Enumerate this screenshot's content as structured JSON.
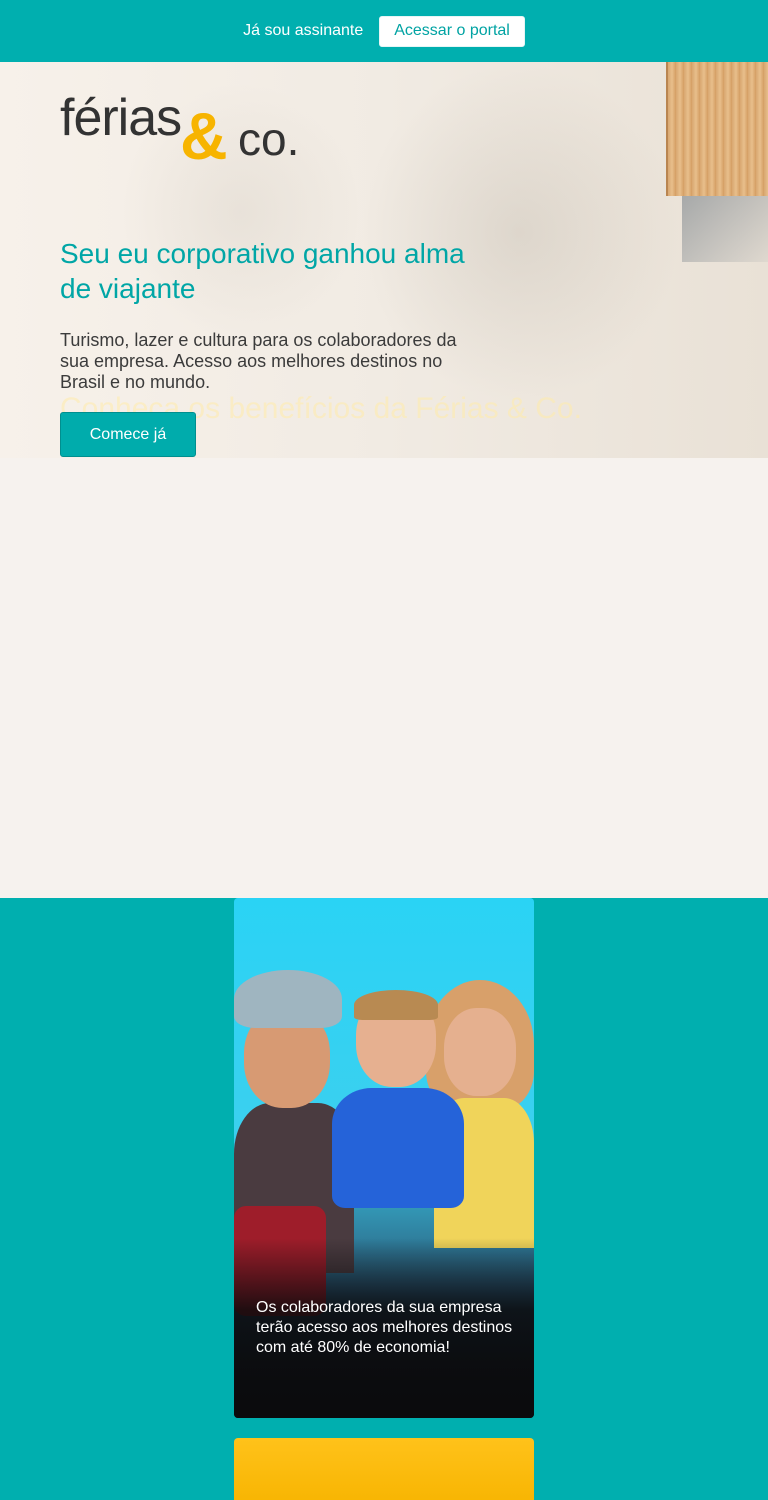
{
  "topbar": {
    "subscriber_text": "Já sou assinante",
    "portal_button": "Acessar o portal"
  },
  "colors": {
    "brand_teal": "#00afaf",
    "brand_yellow": "#f7b400",
    "hero_bg": "#f6f2ee"
  },
  "logo": {
    "word": "férias",
    "amp": "&",
    "co": "co."
  },
  "hero": {
    "headline": "Seu eu corporativo ganhou alma de viajante",
    "subtext": "Turismo, lazer e cultura para os colaboradores da sua empresa. Acesso aos melhores destinos no Brasil e no mundo.",
    "ghost_text": "Conheça os benefícios da Férias & Co.",
    "cta": "Comece já"
  },
  "cards": [
    {
      "text": "Os colaboradores da sua empresa terão acesso aos melhores destinos com até 80% de economia!"
    }
  ]
}
